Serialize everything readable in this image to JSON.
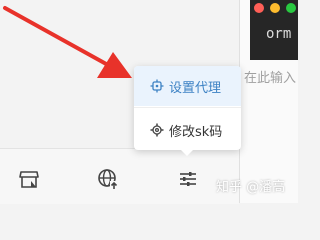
{
  "terminal": {
    "text": "orm",
    "colors": {
      "background": "#262626",
      "close": "#ff5f57",
      "minimize": "#febc2e",
      "maximize": "#28c840"
    }
  },
  "input": {
    "placeholder_visible": "在此输入"
  },
  "toolbar": {
    "items": [
      {
        "icon": "store-icon"
      },
      {
        "icon": "globe-upload-icon"
      },
      {
        "icon": "sliders-icon"
      }
    ]
  },
  "popup_menu": {
    "items": [
      {
        "label": "设置代理",
        "icon": "proxy-chip-icon",
        "state": "hover"
      },
      {
        "label": "修改sk码",
        "icon": "gear-icon"
      }
    ],
    "accent_color": "#3d82c4"
  },
  "annotation": {
    "arrow_color": "#e8322a"
  },
  "watermark": {
    "text": "知乎 @潘高"
  }
}
